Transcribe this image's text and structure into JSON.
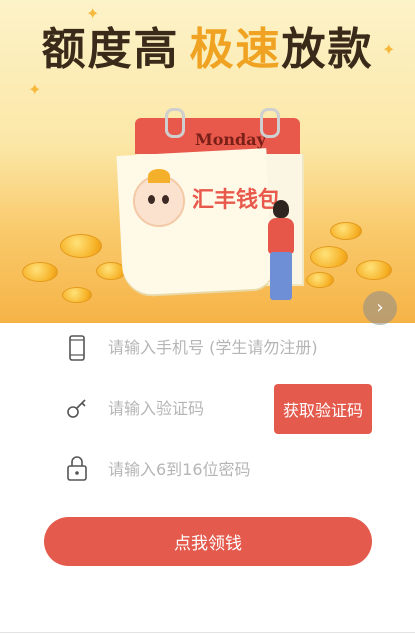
{
  "banner": {
    "headline_part1": "额度高",
    "headline_part2": "极速",
    "headline_part3": "放款",
    "calendar_day": "Monday",
    "brand_name": "汇丰钱包",
    "next_icon": "chevron-right-icon"
  },
  "form": {
    "phone": {
      "placeholder": "请输入手机号 (学生请勿注册)",
      "icon": "phone-icon"
    },
    "code": {
      "placeholder": "请输入验证码",
      "icon": "key-icon",
      "button_label": "获取验证码"
    },
    "password": {
      "placeholder": "请输入6到16位密码",
      "icon": "lock-icon"
    },
    "submit_label": "点我领钱"
  },
  "colors": {
    "accent": "#e45a4d",
    "headline_dark": "#3a2a1a",
    "headline_accent": "#f0a323",
    "placeholder": "#b5b5b5"
  }
}
